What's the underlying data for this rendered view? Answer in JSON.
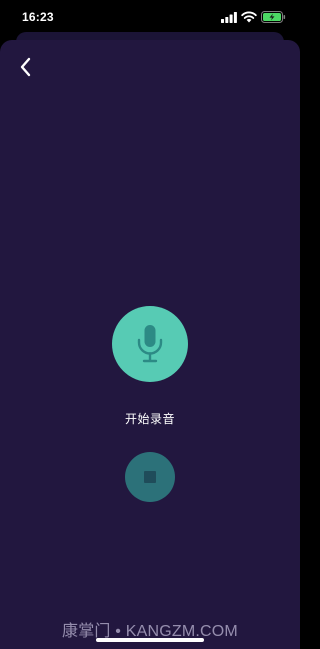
{
  "status_bar": {
    "time": "16:23",
    "icons": [
      "signal-icon",
      "wifi-icon",
      "battery-charging-icon"
    ]
  },
  "navigation": {
    "back_icon": "chevron-left-icon"
  },
  "recorder": {
    "record_icon": "microphone-icon",
    "label": "开始录音",
    "stop_icon": "stop-icon"
  },
  "watermark": {
    "text": "康掌门 • KANGZM.COM"
  },
  "colors": {
    "background": "#22173f",
    "record_button": "#57cbb4",
    "stop_button": "#2c7179"
  }
}
